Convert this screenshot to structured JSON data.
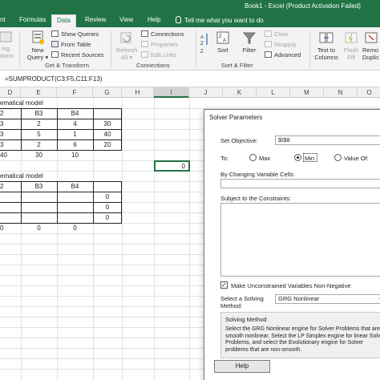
{
  "window": {
    "title": "Book1  -  Excel (Product Activation Failed)"
  },
  "ribbon_tabs": [
    {
      "label": "nt"
    },
    {
      "label": "Formulas"
    },
    {
      "label": "Data"
    },
    {
      "label": "Review"
    },
    {
      "label": "View"
    },
    {
      "label": "Help"
    }
  ],
  "tell_me": "Tell me what you want to do",
  "ribbon": {
    "get_data_left": {
      "line1": "ing",
      "line2": "ctions"
    },
    "new_query": {
      "line1": "New",
      "line2": "Query ▾"
    },
    "show_queries": "Show Queries",
    "from_table": "From Table",
    "recent_sources": "Recent Sources",
    "group_get_transform": "Get & Transform",
    "refresh_all": {
      "line1": "Refresh",
      "line2": "All ▾"
    },
    "connections": "Connections",
    "properties": "Properties",
    "edit_links": "Edit Links",
    "group_connections": "Connections",
    "sort_az_icon": "sort-az-icon",
    "sort": "Sort",
    "filter": "Filter",
    "clear": "Clear",
    "reapply": "Reapply",
    "advanced": "Advanced",
    "group_sort_filter": "Sort & Filter",
    "text_to_columns": {
      "line1": "Text to",
      "line2": "Columns"
    },
    "flash_fill": {
      "line1": "Flash",
      "line2": "Fill"
    },
    "remove_duplicates": {
      "line1": "Remo",
      "line2": "Duplic"
    }
  },
  "formula_bar": {
    "text": "=SUMPRODUCT(C3:F5,C11:F13)"
  },
  "columns": [
    "D",
    "E",
    "F",
    "G",
    "H",
    "I",
    "J",
    "K",
    "L",
    "M",
    "N",
    "O"
  ],
  "sheet": {
    "model1_title": "ematical model",
    "model1_headers": [
      "2",
      "B3",
      "B4",
      ""
    ],
    "model1_rows": [
      [
        "3",
        "2",
        "4",
        "30"
      ],
      [
        "3",
        "5",
        "1",
        "40"
      ],
      [
        "3",
        "2",
        "6",
        "20"
      ],
      [
        "40",
        "30",
        "10",
        ""
      ]
    ],
    "objective_value": "0",
    "model2_title": "ematical model",
    "model2_headers": [
      "2",
      "B3",
      "B4",
      ""
    ],
    "model2_rows": [
      [
        "",
        "",
        "",
        "0"
      ],
      [
        "",
        "",
        "",
        "0"
      ],
      [
        "",
        "",
        "",
        "0"
      ],
      [
        "0",
        "0",
        "0",
        ""
      ]
    ]
  },
  "solver": {
    "title": "Solver Parameters",
    "set_objective_label": "Set Objective:",
    "set_objective_value": "$I$8",
    "to_label": "To:",
    "max_label": "Max",
    "min_label": "Min",
    "value_of_label": "Value Of:",
    "selected_goal": "Min",
    "changing_cells_label": "By Changing Variable Cells:",
    "changing_cells_value": "",
    "constraints_label": "Subject to the Constraints:",
    "nonneg_label": "Make Unconstrained Variables Non-Negative",
    "nonneg_checked": true,
    "select_method_label_1": "Select a Solving",
    "select_method_label_2": "Method:",
    "method_value": "GRG Nonlinear",
    "method_box_title": "Solving Method",
    "method_box_text": "Select the GRG Nonlinear engine for Solver Problems that are smooth nonlinear. Select the LP Simplex engine for linear Solver Problems, and select the Evolutionary engine for Solver problems that are non-smooth.",
    "help_button": "Help"
  },
  "colors": {
    "accent": "#217346",
    "ribbon_bg": "#f3f3f3",
    "grid_line": "#e1e1e1"
  }
}
